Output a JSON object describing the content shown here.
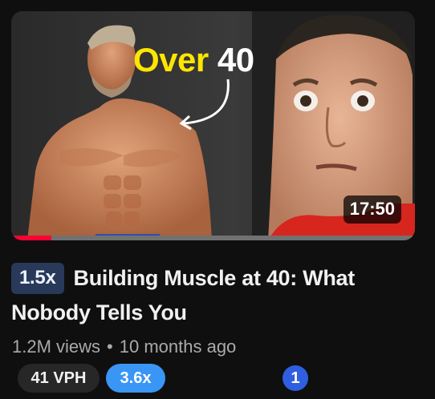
{
  "thumbnail": {
    "headline_part1": "Over",
    "headline_part2": "40",
    "duration": "17:50",
    "watch_progress": 0.1,
    "colors": {
      "headline_accent": "#ffe600",
      "progress": "#ff0033"
    }
  },
  "video": {
    "speed_badge": "1.5x",
    "title": "Building Muscle at 40: What Nobody Tells You",
    "views": "1.2M views",
    "separator": "•",
    "age": "10 months ago"
  },
  "stats": {
    "vph": "41 VPH",
    "multiplier": "3.6x",
    "rank": "1",
    "colors": {
      "multiplier_bg": "#3a96f5",
      "rank_bg": "#2f5fe0"
    }
  }
}
